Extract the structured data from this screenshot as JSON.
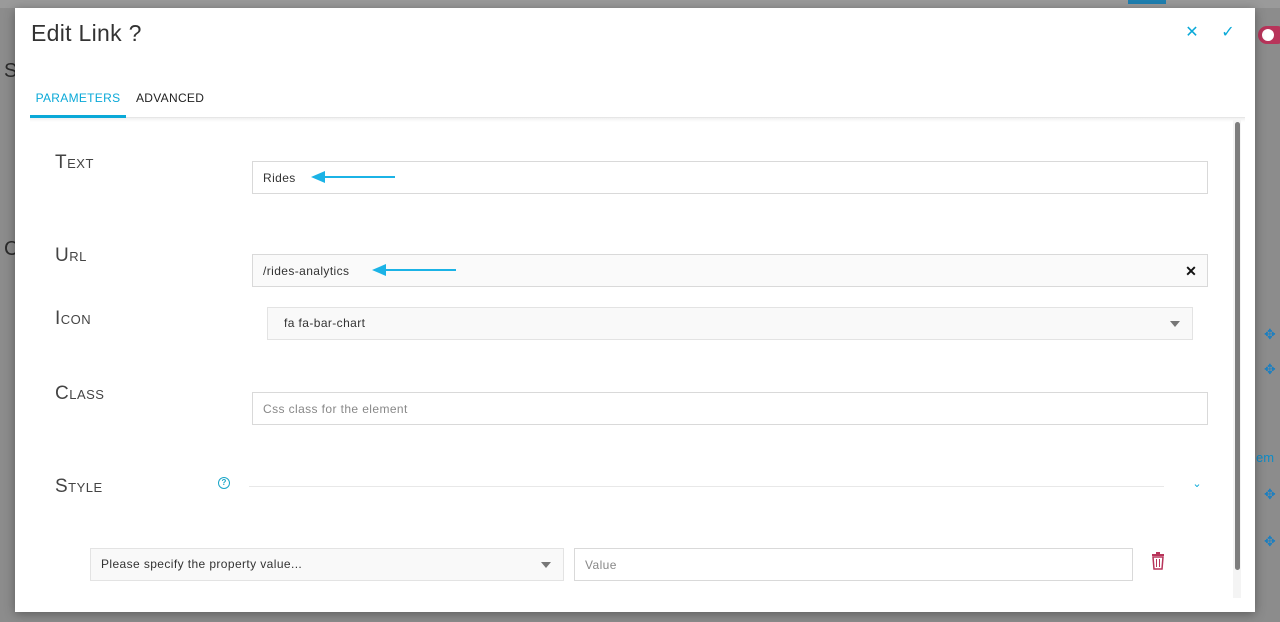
{
  "backdrop": {
    "letters": [
      "S",
      "C"
    ],
    "right_text": "em"
  },
  "modal": {
    "title": "Edit Link ?",
    "close_glyph": "✕",
    "confirm_glyph": "✓"
  },
  "tabs": [
    {
      "label": "PARAMETERS",
      "active": true
    },
    {
      "label": "ADVANCED",
      "active": false
    }
  ],
  "fields": {
    "text": {
      "label": "Text",
      "value": "Rides"
    },
    "url": {
      "label": "Url",
      "value": "/rides-analytics",
      "clear_glyph": "✕"
    },
    "icon": {
      "label": "Icon",
      "selected": "fa fa-bar-chart"
    },
    "class": {
      "label": "Class",
      "value": "",
      "placeholder": "Css class for the element"
    },
    "style": {
      "label": "Style",
      "help_glyph": "?",
      "toggle_glyph": "⌄",
      "property_select": "Please specify the property value...",
      "value_placeholder": "Value"
    }
  },
  "icons": [
    "close-icon",
    "check-icon",
    "arrow-left-icon",
    "clear-icon",
    "chevron-down-icon",
    "question-circle-icon",
    "trash-icon",
    "move-icon"
  ],
  "colors": {
    "accent": "#0aa9d8",
    "arrow": "#1bb3e6",
    "danger": "#b8345a"
  }
}
